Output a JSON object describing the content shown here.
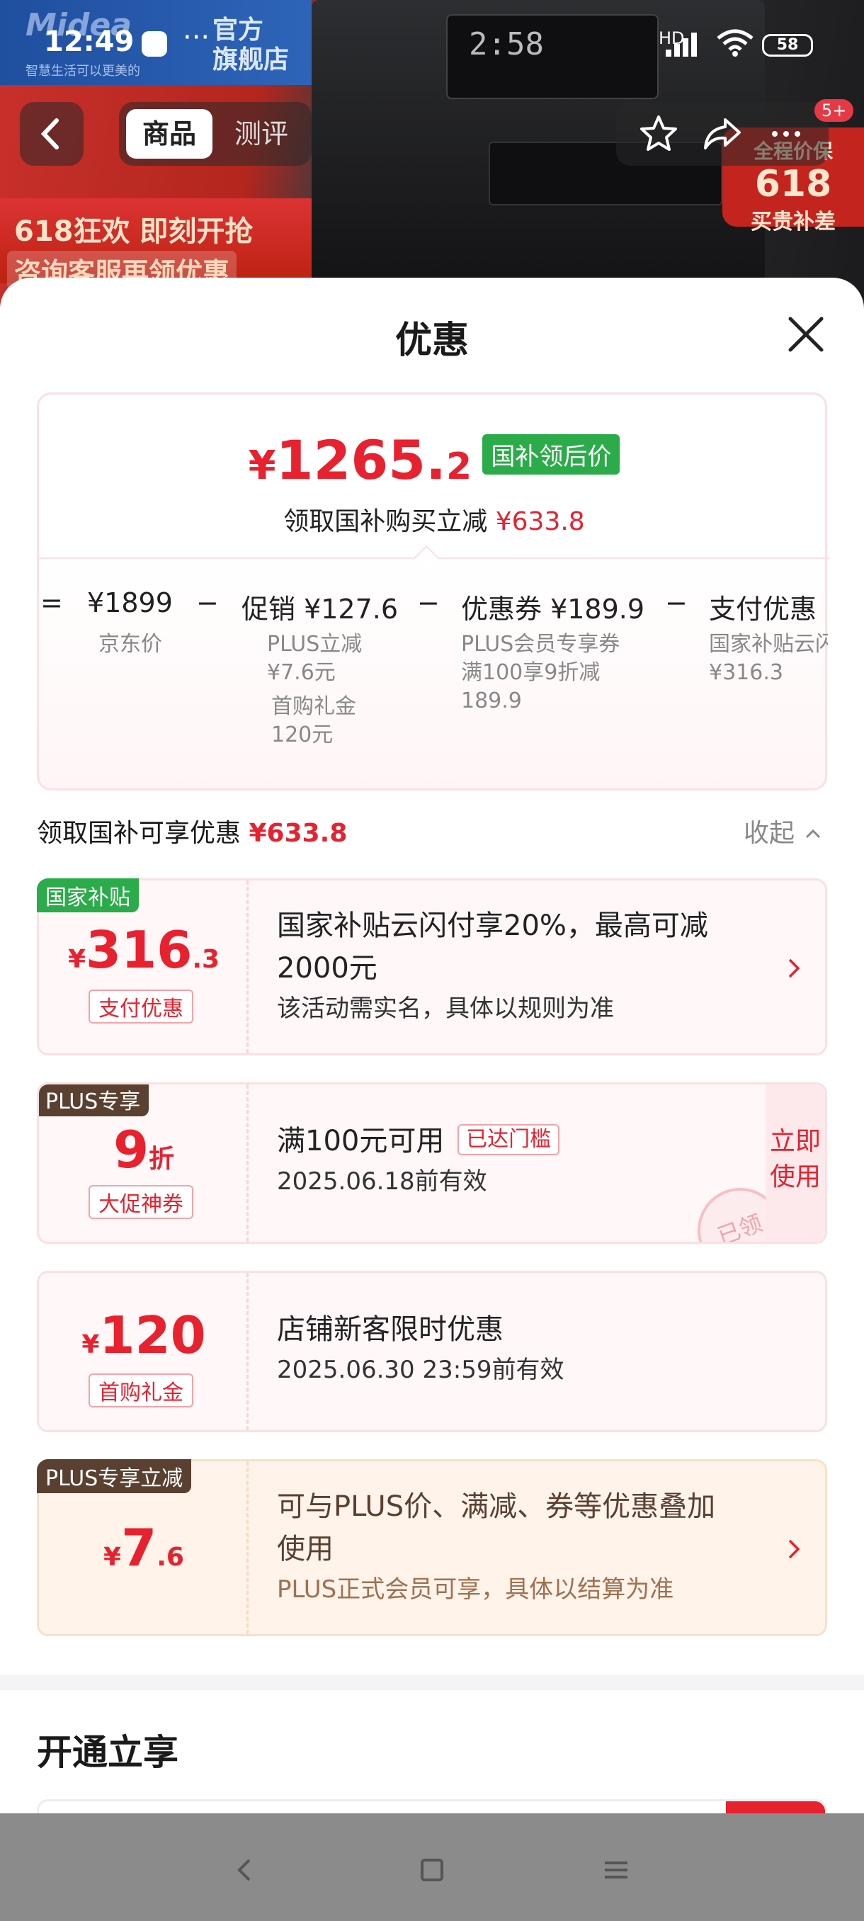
{
  "status_bar": {
    "time": "12:49",
    "network": "HD",
    "wifi_level": "6",
    "battery": "58"
  },
  "background": {
    "brand_official": "官方\n旗舰店",
    "logo": "Midea",
    "slogan": "智慧生活可以更美的",
    "oven_clock": "2:58",
    "promo_line1": "618狂欢 即刻开抢",
    "promo_line2": "咨询客服再领优惠",
    "right_promo_t1": "全程价保",
    "right_promo_t2": "618",
    "right_promo_t3": "买贵补差"
  },
  "nav": {
    "tab_product": "商品",
    "tab_review": "测评",
    "badge": "5+"
  },
  "sheet": {
    "title": "优惠",
    "final_price": {
      "yen": "¥",
      "int": "1265.",
      "dec": "2",
      "tag": "国补领后价"
    },
    "subline": {
      "text": "领取国补购买立减",
      "amount": "¥633.8"
    },
    "calc": {
      "eq": "=",
      "jd_price": "¥1899",
      "jd_label": "京东价",
      "minus": "−",
      "promo": "促销 ¥127.6",
      "promo_sub1": "PLUS立减",
      "promo_sub1b": "¥7.6元",
      "promo_sub2": "首购礼金",
      "promo_sub2b": "120元",
      "coupon": "优惠券 ¥189.9",
      "coupon_sub1": "PLUS会员专享券",
      "coupon_sub2": "满100享9折减",
      "coupon_sub3": "189.9",
      "pay": "支付优惠",
      "pay_sub1": "国家补贴云闪",
      "pay_sub2": "¥316.3"
    },
    "section": {
      "label": "领取国补可享优惠",
      "amount": "¥633.8",
      "collapse": "收起"
    },
    "coupons": [
      {
        "corner": "国家补贴",
        "yen": "¥",
        "int": "316",
        "dec": ".3",
        "pill": "支付优惠",
        "line1": "国家补贴云闪付享20%，最高可减",
        "line2": "2000元",
        "line3": "该活动需实名，具体以规则为准"
      },
      {
        "corner": "PLUS专享",
        "int": "9",
        "unit": "折",
        "pill": "大促神券",
        "line1": "满100元可用",
        "reached": "已达门槛",
        "line2": "2025.06.18前有效",
        "use1": "立即",
        "use2": "使用",
        "stamp": "已领"
      },
      {
        "yen": "¥",
        "int": "120",
        "pill": "首购礼金",
        "line1": "店铺新客限时优惠",
        "line2": "2025.06.30 23:59前有效"
      },
      {
        "corner": "PLUS专享立减",
        "yen": "¥",
        "int": "7",
        "dec": ".6",
        "line1": "可与PLUS价、满减、券等优惠叠加",
        "line2": "使用",
        "line3": "PLUS正式会员可享，具体以结算为准"
      }
    ],
    "open_title": "开通立享"
  },
  "colors": {
    "accent_red": "#e8212f",
    "green_tag": "#2bab4a",
    "plus_brown": "#5a4030"
  }
}
